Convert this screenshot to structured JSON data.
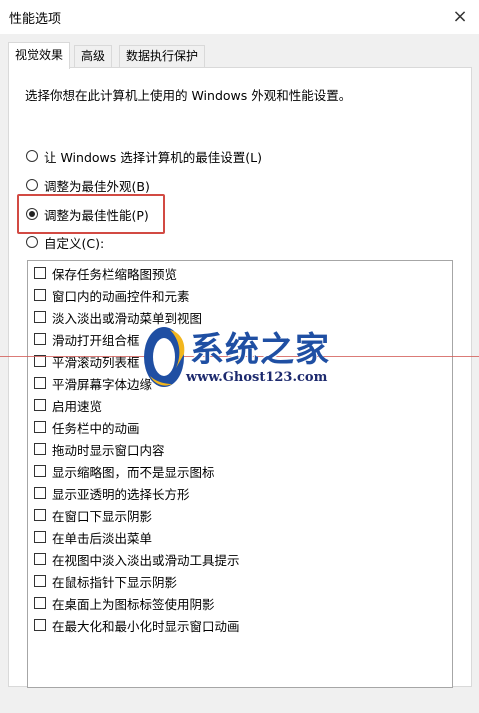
{
  "window": {
    "title": "性能选项",
    "close_icon": "×"
  },
  "tabs": [
    {
      "label": "视觉效果",
      "active": true
    },
    {
      "label": "高级",
      "active": false
    },
    {
      "label": "数据执行保护",
      "active": false
    }
  ],
  "description": "选择你想在此计算机上使用的 Windows 外观和性能设置。",
  "radios": [
    {
      "label": "让 Windows 选择计算机的最佳设置(L)",
      "checked": false
    },
    {
      "label": "调整为最佳外观(B)",
      "checked": false
    },
    {
      "label": "调整为最佳性能(P)",
      "checked": true
    },
    {
      "label": "自定义(C):",
      "checked": false
    }
  ],
  "checkboxes": [
    {
      "label": "保存任务栏缩略图预览",
      "checked": false
    },
    {
      "label": "窗口内的动画控件和元素",
      "checked": false
    },
    {
      "label": "淡入淡出或滑动菜单到视图",
      "checked": false
    },
    {
      "label": "滑动打开组合框",
      "checked": false
    },
    {
      "label": "平滑滚动列表框",
      "checked": false
    },
    {
      "label": "平滑屏幕字体边缘",
      "checked": false
    },
    {
      "label": "启用速览",
      "checked": false
    },
    {
      "label": "任务栏中的动画",
      "checked": false
    },
    {
      "label": "拖动时显示窗口内容",
      "checked": false
    },
    {
      "label": "显示缩略图，而不是显示图标",
      "checked": false
    },
    {
      "label": "显示亚透明的选择长方形",
      "checked": false
    },
    {
      "label": "在窗口下显示阴影",
      "checked": false
    },
    {
      "label": "在单击后淡出菜单",
      "checked": false
    },
    {
      "label": "在视图中淡入淡出或滑动工具提示",
      "checked": false
    },
    {
      "label": "在鼠标指针下显示阴影",
      "checked": false
    },
    {
      "label": "在桌面上为图标标签使用阴影",
      "checked": false
    },
    {
      "label": "在最大化和最小化时显示窗口动画",
      "checked": false
    }
  ],
  "watermark": {
    "name": "系统之家",
    "url": "www.Ghost123.com"
  },
  "colors": {
    "highlight_border": "#d24a43",
    "watermark_blue": "#1f4fa3"
  }
}
